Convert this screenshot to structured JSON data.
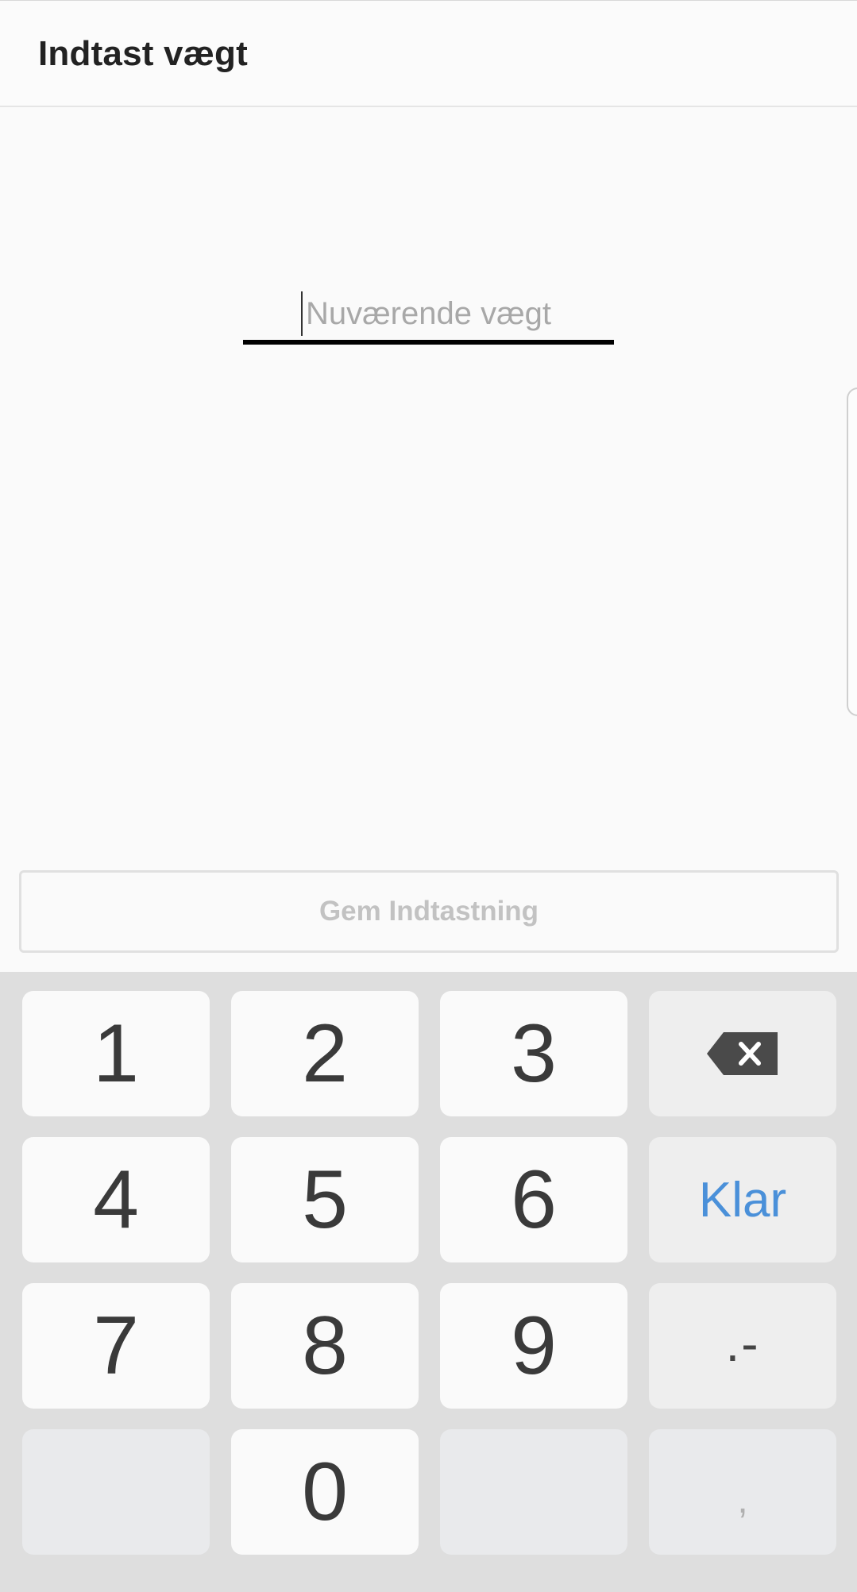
{
  "header": {
    "title": "Indtast vægt"
  },
  "weight_input": {
    "value": "",
    "placeholder": "Nuværende vægt"
  },
  "save_button": {
    "label": "Gem Indtastning"
  },
  "keypad": {
    "keys": {
      "k1": "1",
      "k2": "2",
      "k3": "3",
      "k4": "4",
      "k5": "5",
      "k6": "6",
      "k7": "7",
      "k8": "8",
      "k9": "9",
      "k0": "0",
      "done": "Klar",
      "dot_minus": ".-",
      "comma": ","
    },
    "backspace_icon": "backspace-icon"
  },
  "colors": {
    "accent": "#4a90d9",
    "keyboard_bg": "#dedede",
    "key_bg": "#fafafa",
    "fn_key_bg": "#eeeeee",
    "disabled_text": "#c2c2c2"
  }
}
